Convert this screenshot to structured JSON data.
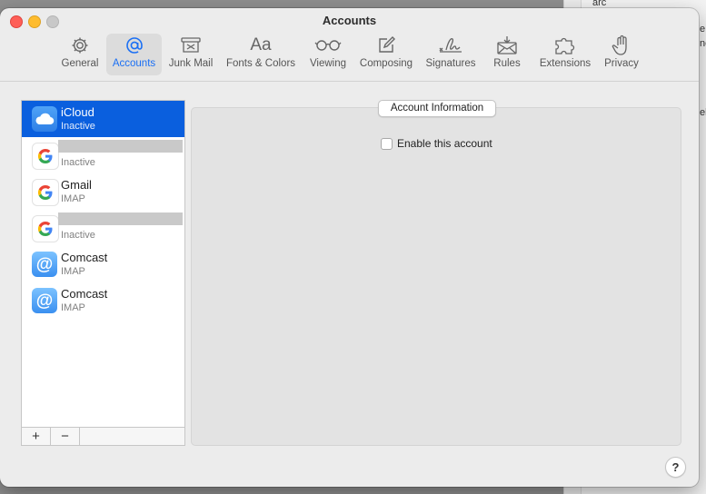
{
  "window": {
    "title": "Accounts"
  },
  "toolbar": {
    "items": [
      {
        "label": "General",
        "icon": "gear-icon"
      },
      {
        "label": "Accounts",
        "icon": "at-sign-icon"
      },
      {
        "label": "Junk Mail",
        "icon": "junk-mail-icon"
      },
      {
        "label": "Fonts & Colors",
        "icon": "fonts-icon"
      },
      {
        "label": "Viewing",
        "icon": "glasses-icon"
      },
      {
        "label": "Composing",
        "icon": "compose-icon"
      },
      {
        "label": "Signatures",
        "icon": "signature-icon"
      },
      {
        "label": "Rules",
        "icon": "rules-envelope-icon"
      },
      {
        "label": "Extensions",
        "icon": "puzzle-piece-icon"
      },
      {
        "label": "Privacy",
        "icon": "hand-icon"
      }
    ],
    "active": "Accounts"
  },
  "accounts": [
    {
      "name": "iCloud",
      "status": "Inactive",
      "icon": "icloud-icon",
      "selected": true
    },
    {
      "name": "",
      "status": "Inactive",
      "icon": "google-icon",
      "redacted": true
    },
    {
      "name": "Gmail",
      "status": "IMAP",
      "icon": "google-icon"
    },
    {
      "name": "",
      "status": "Inactive",
      "icon": "google-icon",
      "redacted": true
    },
    {
      "name": "Comcast",
      "status": "IMAP",
      "icon": "at-mail-icon"
    },
    {
      "name": "Comcast",
      "status": "IMAP",
      "icon": "at-mail-icon"
    }
  ],
  "list_footer": {
    "add_label": "+",
    "remove_label": "−"
  },
  "detail": {
    "tab_label": "Account Information",
    "enable_label": "Enable this account",
    "enable_checked": false
  },
  "help": {
    "label": "?"
  },
  "background_window": {
    "texts": [
      "arc",
      "e",
      "ne",
      "el"
    ]
  },
  "colors": {
    "accent": "#1a6ff4",
    "selection": "#0a5fde"
  }
}
